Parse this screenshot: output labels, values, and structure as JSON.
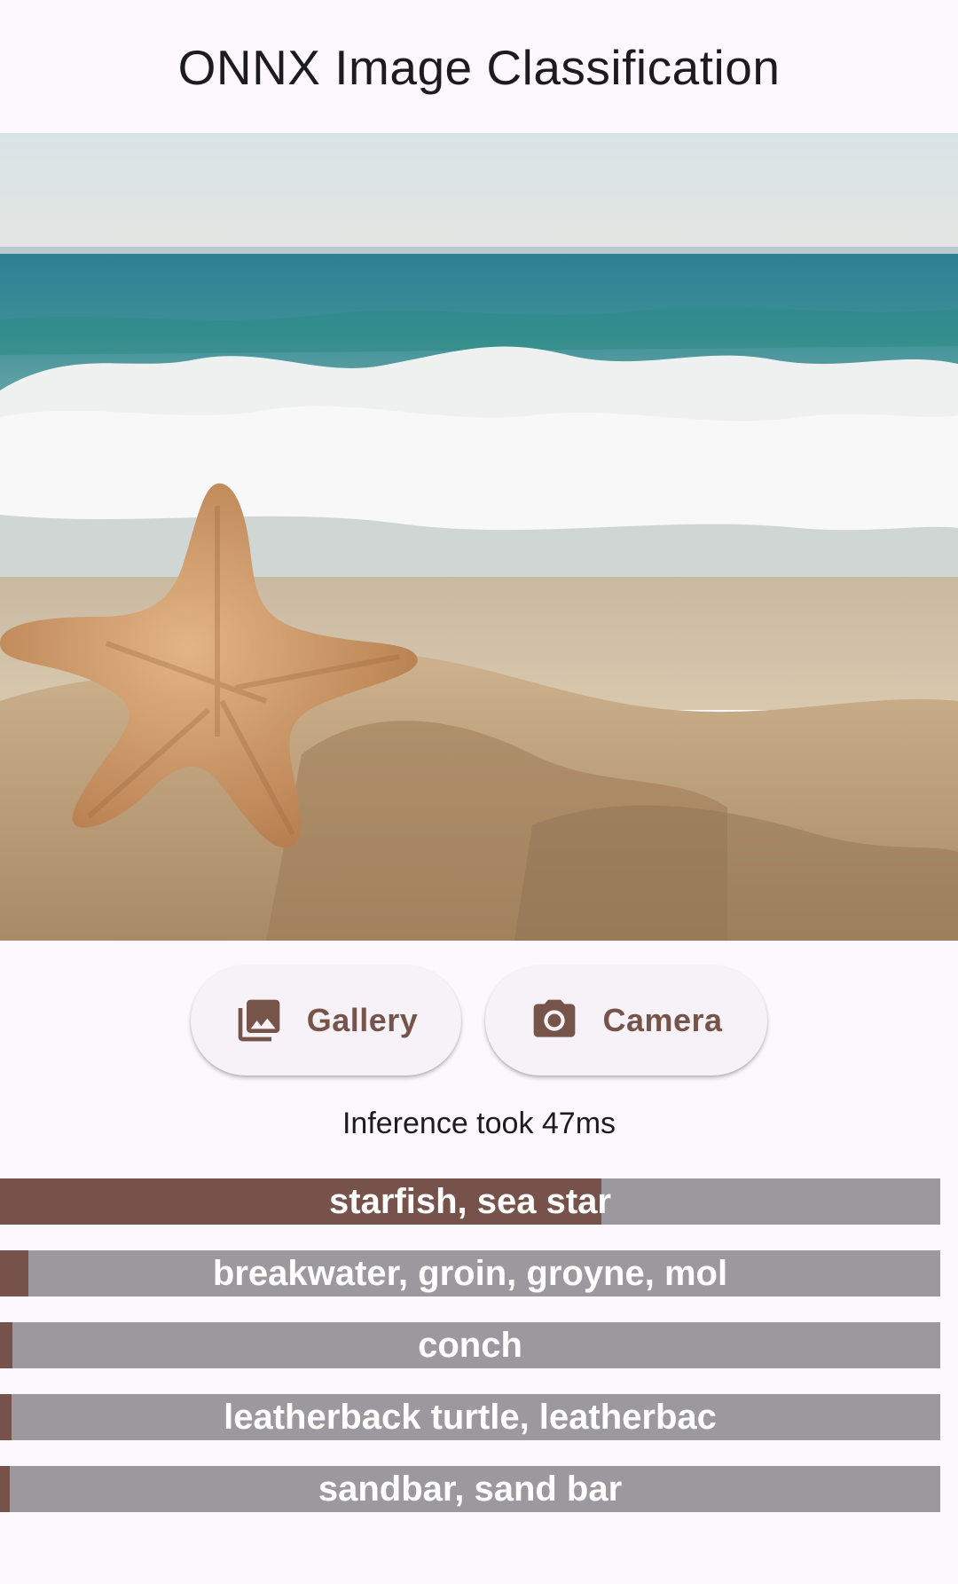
{
  "app": {
    "title": "ONNX Image Classification"
  },
  "image": {
    "subject": "starfish-on-beach-photo"
  },
  "actions": {
    "gallery_label": "Gallery",
    "camera_label": "Camera",
    "gallery_icon": "photo-library-icon",
    "camera_icon": "camera-icon"
  },
  "inference": {
    "text": "Inference took 47ms"
  },
  "colors": {
    "accent": "#76524a",
    "bar_track": "#9c999e",
    "background": "#fdf8fd"
  },
  "predictions": [
    {
      "label": "starfish, sea star",
      "score": 0.64
    },
    {
      "label": "breakwater, groin, groyne, mol",
      "score": 0.03
    },
    {
      "label": "conch",
      "score": 0.013
    },
    {
      "label": "leatherback turtle, leatherbac",
      "score": 0.012
    },
    {
      "label": "sandbar, sand bar",
      "score": 0.01
    }
  ]
}
